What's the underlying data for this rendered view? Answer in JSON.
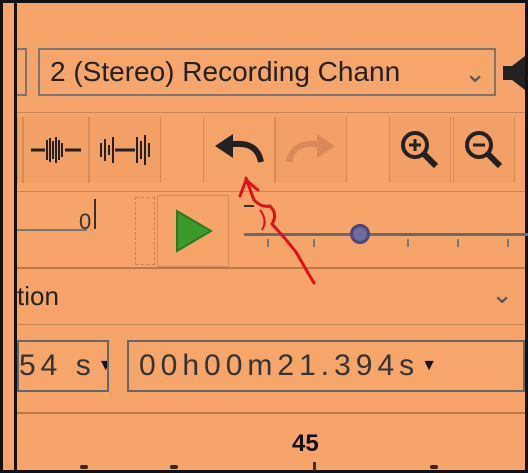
{
  "device_toolbar": {
    "recording_channels": "2 (Stereo) Recording Chann"
  },
  "edit_toolbar": {
    "buttons": [
      "trim-audio",
      "silence-audio",
      "undo",
      "redo",
      "zoom-in",
      "zoom-out"
    ]
  },
  "play_at_speed": {
    "meter_label": "0",
    "speed": 0.4
  },
  "selection_toolbar": {
    "dropdown_partial": "tion",
    "start_time_partial": "54 s",
    "end_time": "00h00m21.394s"
  },
  "time_ruler": {
    "label": "45"
  },
  "colors": {
    "background": "#f6a46a",
    "annotation": "#e0101a",
    "play": "#3a9a2a",
    "slider_knob": "#6c6aa0"
  }
}
